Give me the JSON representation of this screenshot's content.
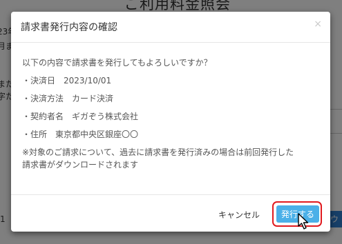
{
  "background": {
    "title": "ご利用料金照会",
    "fragments": [
      "23年",
      "月ま",
      "また",
      "字た",
      "1",
      "ウ"
    ]
  },
  "modal": {
    "title": "請求書発行内容の確認",
    "close": "×",
    "question": "以下の内容で請求書を発行してもよろしいですか？",
    "details": [
      "・決済日　2023/10/01",
      "・決済方法　カード決済",
      "・契約者名　ギガぞう株式会社",
      "・住所　東京都中央区銀座〇〇"
    ],
    "note_line1": "※対象のご請求について、過去に請求書を発行済みの場合は前回発行した",
    "note_line2": "請求書がダウンロードされます",
    "cancel_label": "キャンセル",
    "issue_label": "発行する"
  },
  "colors": {
    "primary_button": "#4bb0e8",
    "highlight": "#e0191e"
  },
  "icons": [
    "close-icon",
    "mouse-pointer-icon"
  ]
}
